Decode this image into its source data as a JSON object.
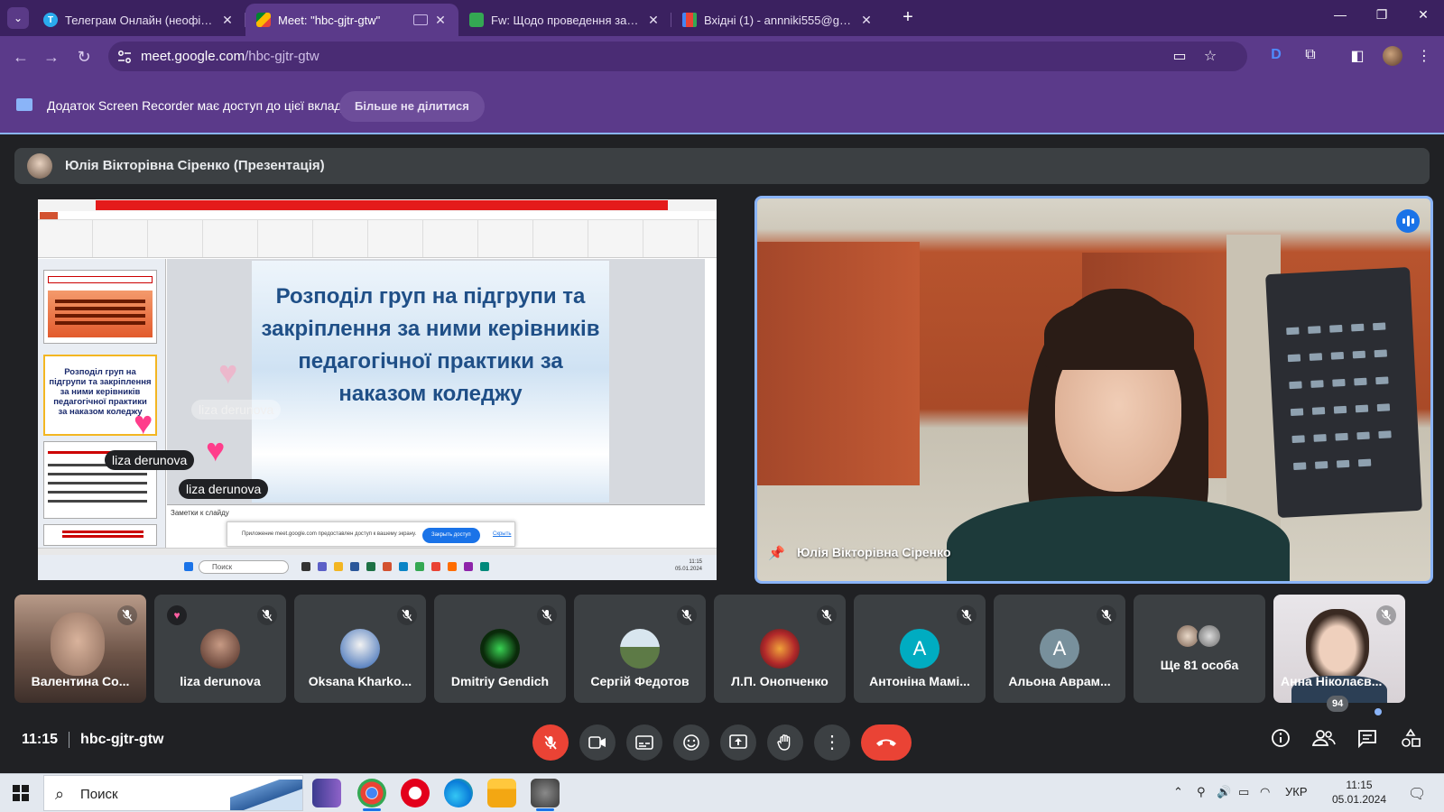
{
  "browser": {
    "tabs": [
      {
        "title": "Телеграм Онлайн (неофіційн...",
        "favicon": "telegram-icon",
        "active": false
      },
      {
        "title": "Meet: \"hbc-gjtr-gtw\"",
        "favicon": "google-meet-icon",
        "active": true
      },
      {
        "title": "Fw: Щодо проведення заходу...",
        "favicon": "sheet-icon",
        "active": false
      },
      {
        "title": "Вхідні (1) - annniki555@gmail.c...",
        "favicon": "gmail-icon",
        "active": false
      }
    ],
    "url_host": "meet.google.com",
    "url_path": "/hbc-gjtr-gtw"
  },
  "banner": {
    "text": "Додаток Screen Recorder має доступ до цієї вкладки",
    "button_label": "Більше не ділитися"
  },
  "presenter": {
    "label": "Юлія Вікторівна Сіренко (Презентація)"
  },
  "presentation": {
    "slide_title": "Розподіл груп на підгрупи та закріплення за ними керівників педагогічної практики за наказом коледжу",
    "thumb_text": "Розподіл груп на підгрупи та закріплення за ними керівників педагогічної практики за наказом коледжу",
    "notes_label": "Заметки к слайду",
    "share_notice": "Приложение meet.google.com предоставлен доступ к вашему экрану.",
    "share_stop": "Закрыть доступ",
    "share_hide": "Скрыть",
    "taskbar_search": "Поиск",
    "screen_time": "11:15",
    "screen_date": "05.01.2024"
  },
  "reactions": [
    {
      "name": "liza derunova",
      "style": "faded"
    },
    {
      "name": "liza derunova",
      "style": "solid"
    },
    {
      "name": "liza derunova",
      "style": "solid"
    }
  ],
  "speaker": {
    "name": "Юлія Вікторівна Сіренко"
  },
  "participants": [
    {
      "name": "Валентина Со...",
      "type": "video"
    },
    {
      "name": "liza derunova",
      "type": "avatar",
      "reaction": "heart"
    },
    {
      "name": "Oksana Kharko...",
      "type": "avatar"
    },
    {
      "name": "Dmitriy Gendich",
      "type": "avatar"
    },
    {
      "name": "Сергій Федотов",
      "type": "avatar"
    },
    {
      "name": "Л.П. Онопченко",
      "type": "avatar"
    },
    {
      "name": "Антоніна Мамі...",
      "type": "letter",
      "letter": "A",
      "color": "#00acc1"
    },
    {
      "name": "Альона Аврам...",
      "type": "letter",
      "letter": "A",
      "color": "#78909c"
    },
    {
      "name": "Ще 81 особа",
      "type": "more"
    },
    {
      "name": "Анна Ніколаєв...",
      "type": "video"
    }
  ],
  "meeting": {
    "time": "11:15",
    "code": "hbc-gjtr-gtw",
    "participant_count": "94"
  },
  "windows": {
    "search_placeholder": "Поиск",
    "language": "УКР",
    "time": "11:15",
    "date": "05.01.2024"
  },
  "colors": {
    "browser_frame": "#3b2160",
    "browser_toolbar": "#5b3a8a",
    "meet_bg": "#202124",
    "tile_bg": "#3c4043",
    "accent_blue": "#8ab4f8",
    "danger_red": "#ea4335"
  }
}
